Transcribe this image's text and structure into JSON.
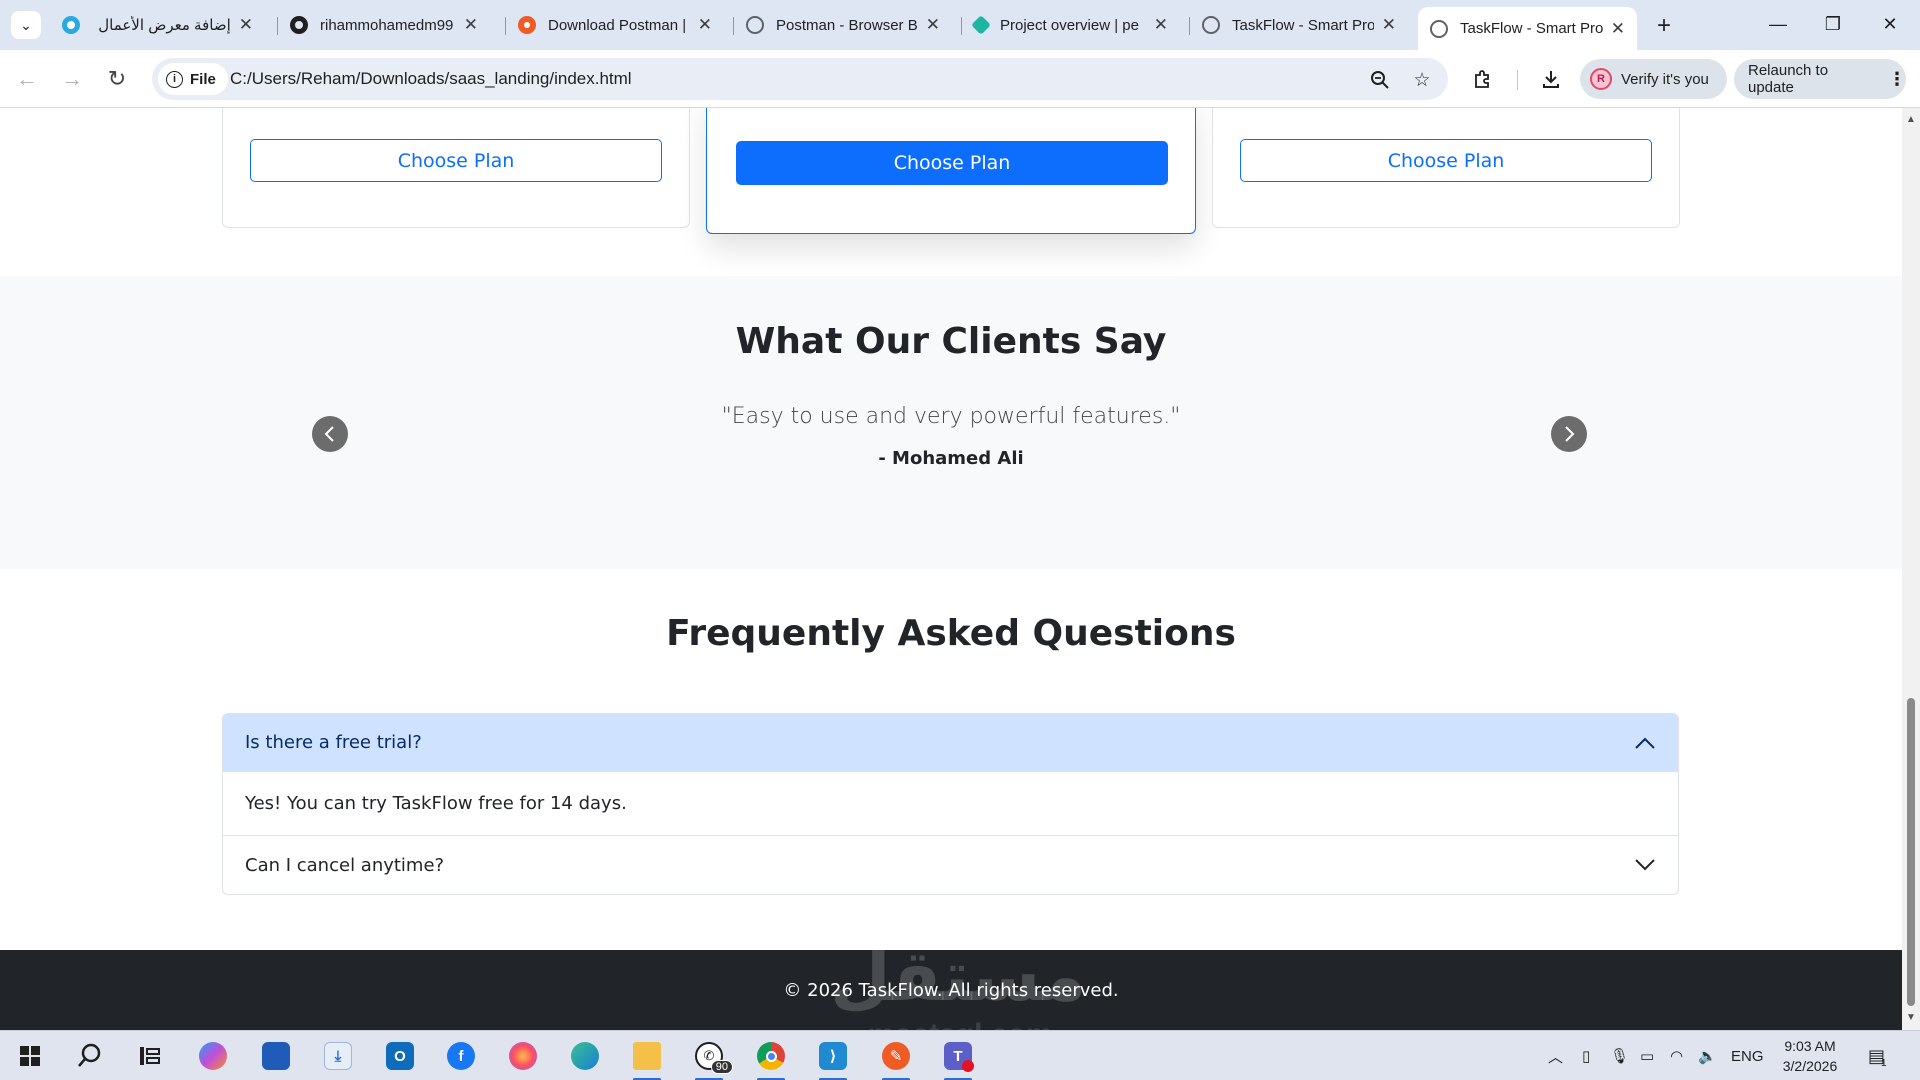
{
  "browser": {
    "tabs": [
      {
        "title": "إضافة معرض الأعمال",
        "favicon_color": "#29a9e0"
      },
      {
        "title": "rihammohamedm99",
        "favicon_color": "#1f1f1f"
      },
      {
        "title": "Download Postman |",
        "favicon_color": "#ef5b25"
      },
      {
        "title": "Postman - Browser B",
        "favicon_color": "#5f6368"
      },
      {
        "title": "Project overview | pe",
        "favicon_color": "#1fb5a3"
      },
      {
        "title": "TaskFlow - Smart Pro",
        "favicon_color": "#5f6368"
      },
      {
        "title": "TaskFlow - Smart Pro",
        "favicon_color": "#5f6368"
      }
    ],
    "site_label": "File",
    "url": "C:/Users/Reham/Downloads/saas_landing/index.html",
    "verify_label": "Verify it's you",
    "avatar_initial": "R",
    "relaunch_label": "Relaunch to update"
  },
  "pricing": {
    "buttons": [
      "Choose Plan",
      "Choose Plan",
      "Choose Plan"
    ]
  },
  "testimonials": {
    "title": "What Our Clients Say",
    "quote": "\"Easy to use and very powerful features.\"",
    "author": "- Mohamed Ali"
  },
  "faq": {
    "title": "Frequently Asked Questions",
    "items": [
      {
        "question": "Is there a free trial?",
        "answer": "Yes! You can try TaskFlow free for 14 days.",
        "open": true
      },
      {
        "question": "Can I cancel anytime?",
        "open": false
      }
    ]
  },
  "footer": {
    "text": "© 2026 TaskFlow. All rights reserved."
  },
  "watermark": {
    "main": "مستقل",
    "sub": "mostaql.com"
  },
  "taskbar": {
    "whatsapp_badge": "90",
    "language": "ENG",
    "time": "9:03 AM",
    "date": "3/2/2026",
    "notification_count": "1"
  },
  "colors": {
    "primary": "#0d6efd",
    "section_bg": "#f8f9fa",
    "accordion_open_bg": "#cfe2ff",
    "footer_bg": "#212529"
  }
}
